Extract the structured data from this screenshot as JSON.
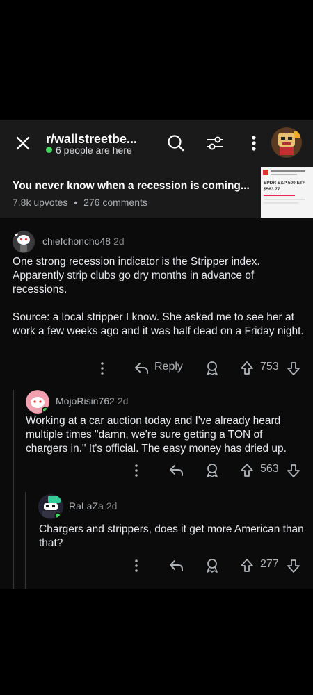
{
  "header": {
    "subreddit": "r/wallstreetbe...",
    "online": "6 people are here",
    "icons": [
      "close-icon",
      "search-icon",
      "filter-icon",
      "more-icon"
    ]
  },
  "post": {
    "title": "You never know when a recession is coming...",
    "upvotes": "7.8k upvotes",
    "separator": "•",
    "comments": "276 comments",
    "thumb_lines": [
      "SPDR S&P 500 ETF",
      "$563.77"
    ]
  },
  "comments": [
    {
      "user": "chiefchoncho48",
      "age": "2d",
      "paragraphs": [
        "One strong recession indicator is the Stripper index. Apparently strip clubs go dry months in advance of recessions.",
        "Source: a local stripper I know. She asked me to see her at work a few weeks ago and it was half dead on a Friday night."
      ],
      "reply_label": "Reply",
      "votes": "753"
    },
    {
      "user": "MojoRisin762",
      "age": "2d",
      "paragraphs": [
        "Working at a car auction today and I've already heard multiple times \"damn, we're sure getting a TON of chargers in.\"  It's official. The easy money has dried up."
      ],
      "votes": "563"
    },
    {
      "user": "RaLaZa",
      "age": "2d",
      "paragraphs": [
        "Chargers and strippers, does it get more American than that?"
      ],
      "votes": "277"
    }
  ],
  "colors": {
    "online": "#46d160",
    "header_bg": "#1a1a1b",
    "app_bg": "#0b0b0b"
  }
}
